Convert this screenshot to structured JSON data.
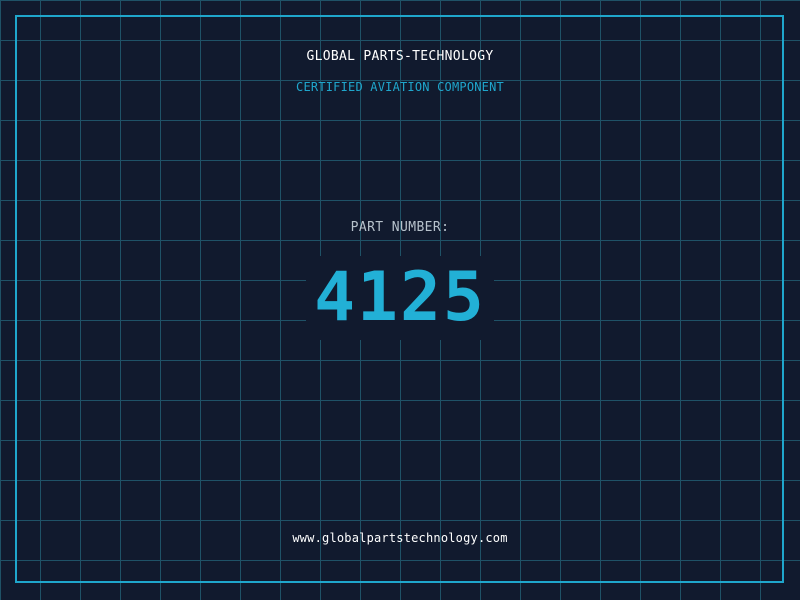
{
  "label": {
    "company": "GLOBAL PARTS-TECHNOLOGY",
    "subtitle": "CERTIFIED AVIATION COMPONENT",
    "part_label": "PART NUMBER:",
    "part_number": "4125",
    "website": "www.globalpartstechnology.com"
  },
  "colors": {
    "background": "#111a2e",
    "grid": "#1f5267",
    "accent": "#1fa6cc",
    "text": "#ffffff"
  }
}
